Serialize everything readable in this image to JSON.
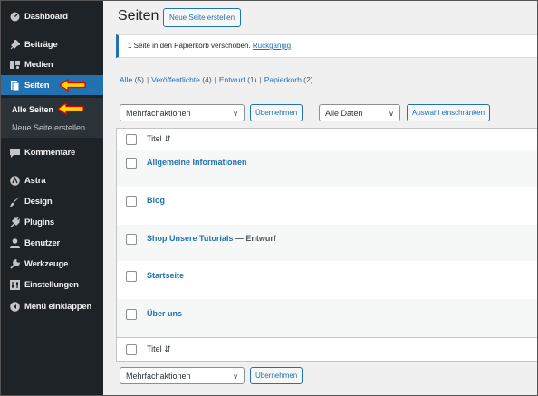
{
  "sidebar": {
    "items": [
      {
        "label": "Dashboard",
        "icon": "dashboard-icon"
      },
      {
        "label": "Beiträge",
        "icon": "pin-icon"
      },
      {
        "label": "Medien",
        "icon": "media-icon"
      },
      {
        "label": "Seiten",
        "icon": "page-icon"
      },
      {
        "label": "Kommentare",
        "icon": "comment-icon"
      },
      {
        "label": "Astra",
        "icon": "astra-icon"
      },
      {
        "label": "Design",
        "icon": "brush-icon"
      },
      {
        "label": "Plugins",
        "icon": "plug-icon"
      },
      {
        "label": "Benutzer",
        "icon": "user-icon"
      },
      {
        "label": "Werkzeuge",
        "icon": "wrench-icon"
      },
      {
        "label": "Einstellungen",
        "icon": "settings-icon"
      },
      {
        "label": "Menü einklappen",
        "icon": "collapse-icon"
      }
    ],
    "submenu": [
      "Alle Seiten",
      "Neue Seite erstellen"
    ]
  },
  "header": {
    "title": "Seiten",
    "new_button": "Neue Seite erstellen"
  },
  "notice": {
    "text": "1 Seite in den Papierkorb verschoben.",
    "link": "Rückgängig"
  },
  "views": [
    {
      "label": "Alle",
      "count": "(5)"
    },
    {
      "label": "Veröffentlichte",
      "count": "(4)"
    },
    {
      "label": "Entwurf",
      "count": "(1)"
    },
    {
      "label": "Papierkorb",
      "count": "(2)"
    }
  ],
  "bulk": {
    "action_select": "Mehrfachaktionen",
    "apply": "Übernehmen",
    "date_select": "Alle Daten",
    "filter": "Auswahl einschränken"
  },
  "table": {
    "column_title": "Titel",
    "rows": [
      {
        "title": "Allgemeine Informationen",
        "state": ""
      },
      {
        "title": "Blog",
        "state": ""
      },
      {
        "title": "Shop Unsere Tutorials",
        "state": " — Entwurf"
      },
      {
        "title": "Startseite",
        "state": ""
      },
      {
        "title": "Über uns",
        "state": ""
      }
    ]
  },
  "colors": {
    "sidebar_bg": "#1d2327",
    "accent": "#2271b1",
    "highlight_arrow": "#ffd700",
    "arrow_outline": "#e00000"
  }
}
